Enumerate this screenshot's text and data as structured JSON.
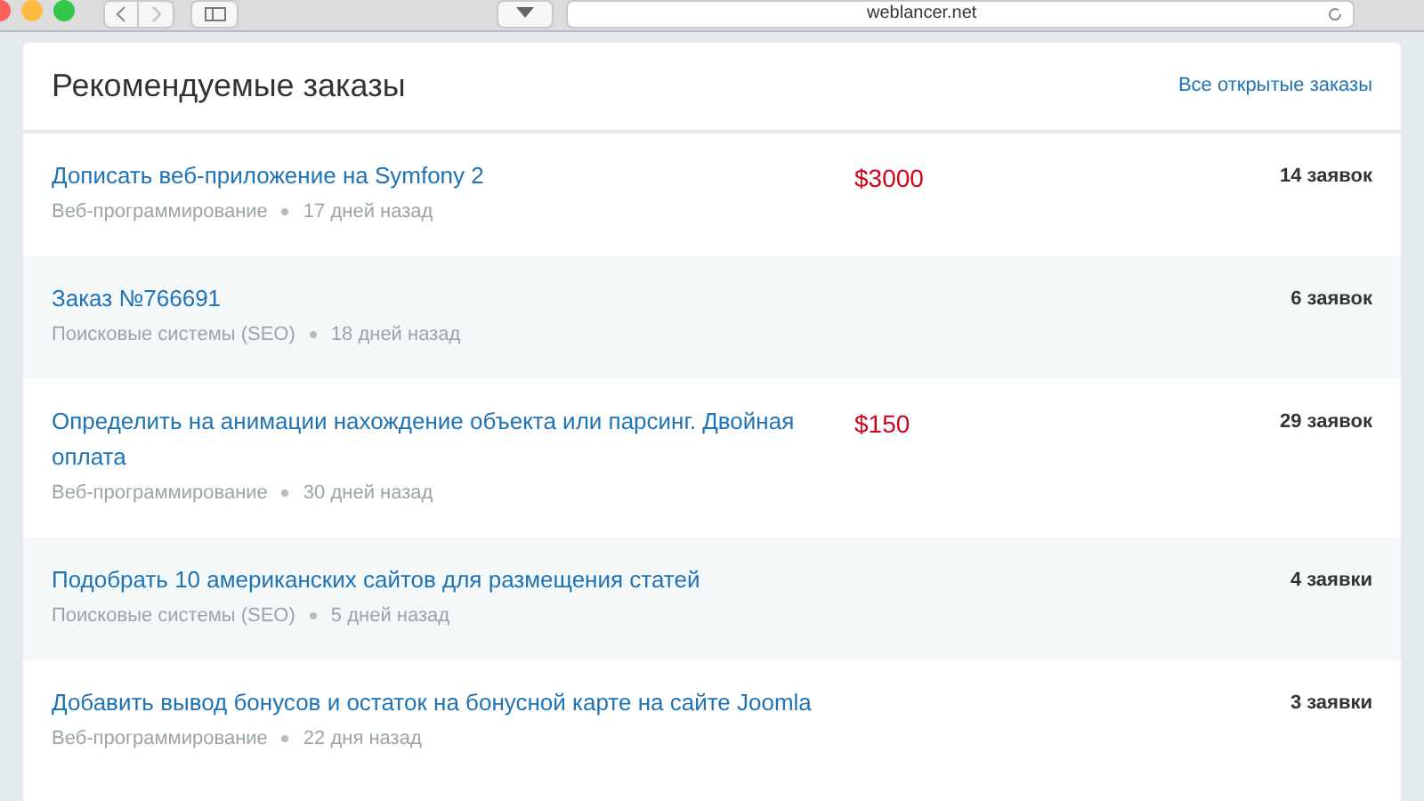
{
  "browser": {
    "url": "weblancer.net"
  },
  "panel": {
    "title": "Рекомендуемые заказы",
    "link": "Все открытые заказы"
  },
  "orders": [
    {
      "title": "Дописать веб-приложение на Symfony 2",
      "price": "$3000",
      "category": "Веб-программирование",
      "age": "17 дней назад",
      "bids": "14 заявок"
    },
    {
      "title": "Заказ №766691",
      "category": "Поисковые системы (SEO)",
      "age": "18 дней назад",
      "bids": "6 заявок"
    },
    {
      "title": "Определить на анимации нахождение объекта или парсинг. Двойная оплата",
      "price": "$150",
      "category": "Веб-программирование",
      "age": "30 дней назад",
      "bids": "29 заявок"
    },
    {
      "title": "Подобрать 10 американских сайтов для размещения статей",
      "category": "Поисковые системы (SEO)",
      "age": "5 дней назад",
      "bids": "4 заявки"
    },
    {
      "title": "Добавить вывод бонусов и остаток на бонусной карте на сайте Joomla",
      "category": "Веб-программирование",
      "age": "22 дня назад",
      "bids": "3 заявки"
    }
  ]
}
